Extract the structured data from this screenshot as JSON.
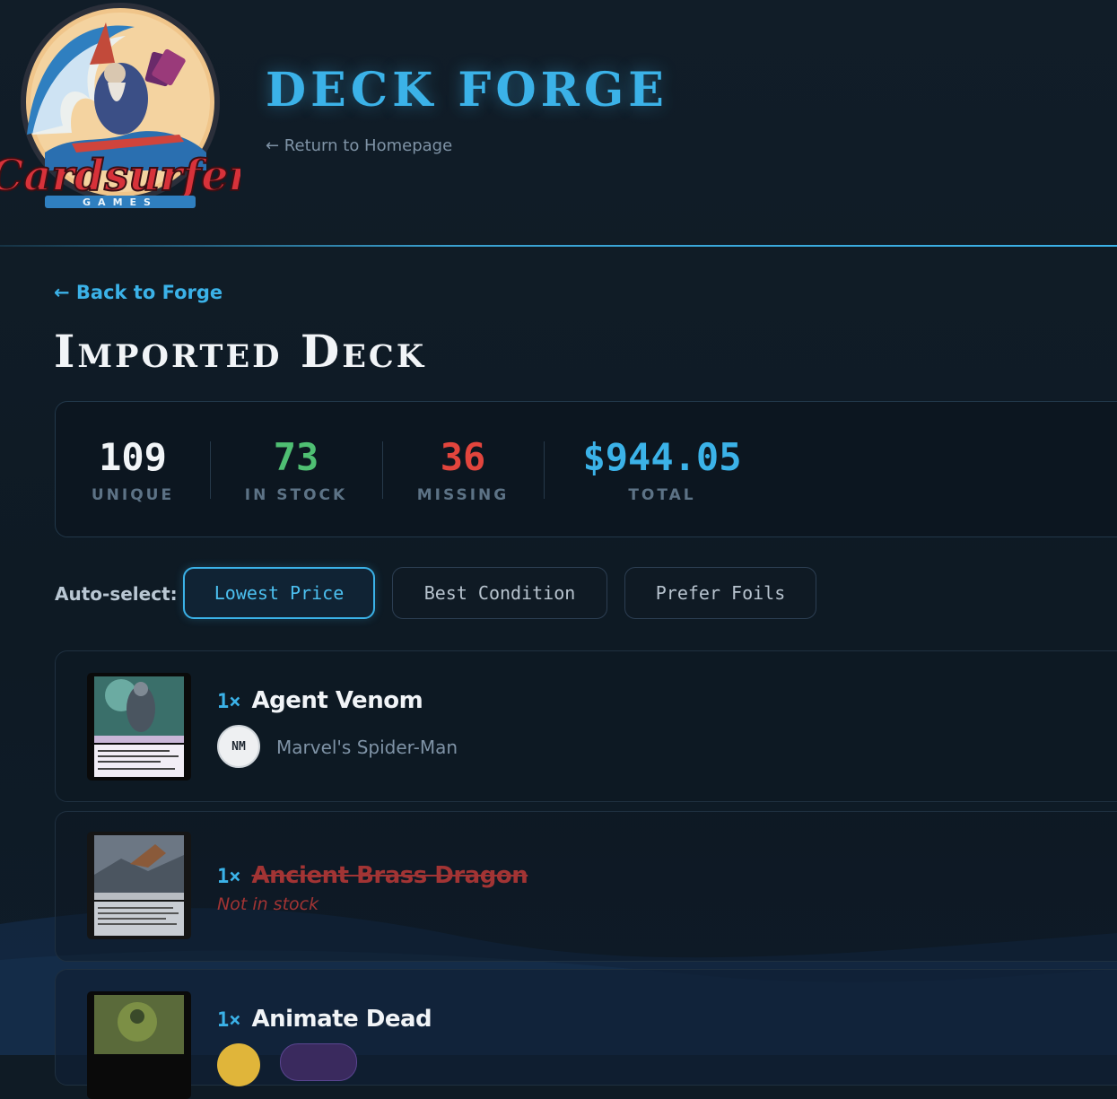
{
  "header": {
    "logo_text": "Cardsurfer",
    "logo_subtext": "GAMES",
    "site_title": "DECK FORGE",
    "return_link": "← Return to Homepage"
  },
  "nav": {
    "back_link": "← Back to Forge"
  },
  "page": {
    "title": "Imported Deck"
  },
  "stats": [
    {
      "value": "109",
      "label": "UNIQUE",
      "color": "#f1f4f7"
    },
    {
      "value": "73",
      "label": "IN STOCK",
      "color": "#4fbf73"
    },
    {
      "value": "36",
      "label": "MISSING",
      "color": "#e2453d"
    },
    {
      "value": "$944.05",
      "label": "TOTAL",
      "color": "#3bb2e8"
    }
  ],
  "autoselect": {
    "label": "Auto-select:",
    "options": [
      "Lowest Price",
      "Best Condition",
      "Prefer Foils"
    ],
    "selected": "Lowest Price"
  },
  "cards": [
    {
      "qty": "1×",
      "name": "Agent Venom",
      "condition": "NM",
      "set": "Marvel's Spider-Man",
      "in_stock": true
    },
    {
      "qty": "1×",
      "name": "Ancient Brass Dragon",
      "note": "Not in stock",
      "in_stock": false
    },
    {
      "qty": "1×",
      "name": "Animate Dead",
      "in_stock": true
    }
  ],
  "colors": {
    "accent": "#3bb2e8",
    "background": "#0f1b25",
    "missing": "#a23434"
  }
}
